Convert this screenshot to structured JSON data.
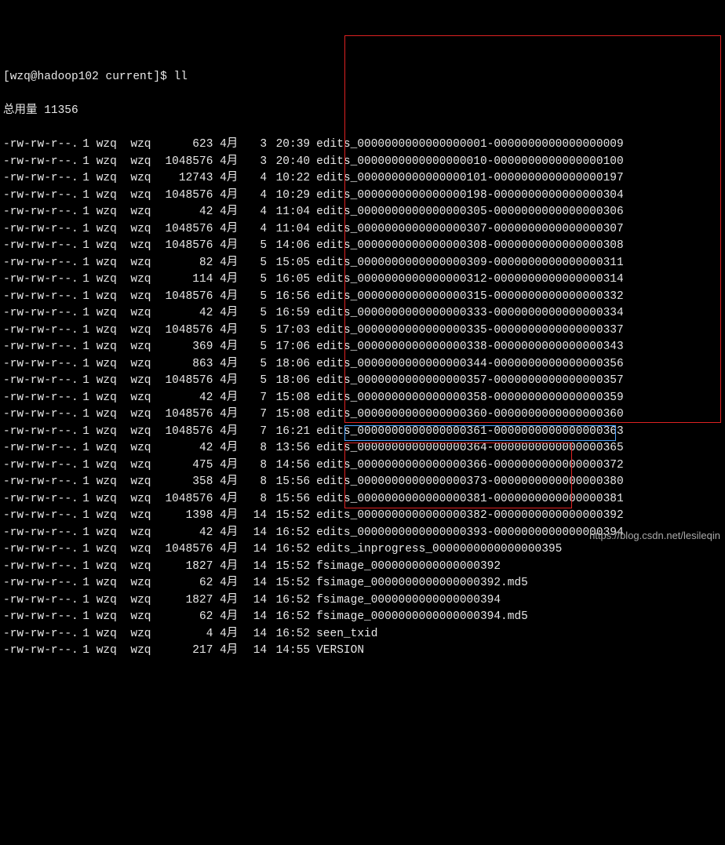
{
  "prompt": "[wzq@hadoop102 current]$ ll",
  "total_line": "总用量 11356",
  "watermark": "https://blog.csdn.net/lesileqin",
  "rows": [
    {
      "perm": "-rw-rw-r--.",
      "links": "1",
      "owner": "wzq",
      "group": "wzq",
      "size": "623",
      "month": "4月",
      "day": "3",
      "time": "20:39",
      "fname": "edits_0000000000000000001-0000000000000000009"
    },
    {
      "perm": "-rw-rw-r--.",
      "links": "1",
      "owner": "wzq",
      "group": "wzq",
      "size": "1048576",
      "month": "4月",
      "day": "3",
      "time": "20:40",
      "fname": "edits_0000000000000000010-0000000000000000100"
    },
    {
      "perm": "-rw-rw-r--.",
      "links": "1",
      "owner": "wzq",
      "group": "wzq",
      "size": "12743",
      "month": "4月",
      "day": "4",
      "time": "10:22",
      "fname": "edits_0000000000000000101-0000000000000000197"
    },
    {
      "perm": "-rw-rw-r--.",
      "links": "1",
      "owner": "wzq",
      "group": "wzq",
      "size": "1048576",
      "month": "4月",
      "day": "4",
      "time": "10:29",
      "fname": "edits_0000000000000000198-0000000000000000304"
    },
    {
      "perm": "-rw-rw-r--.",
      "links": "1",
      "owner": "wzq",
      "group": "wzq",
      "size": "42",
      "month": "4月",
      "day": "4",
      "time": "11:04",
      "fname": "edits_0000000000000000305-0000000000000000306"
    },
    {
      "perm": "-rw-rw-r--.",
      "links": "1",
      "owner": "wzq",
      "group": "wzq",
      "size": "1048576",
      "month": "4月",
      "day": "4",
      "time": "11:04",
      "fname": "edits_0000000000000000307-0000000000000000307"
    },
    {
      "perm": "-rw-rw-r--.",
      "links": "1",
      "owner": "wzq",
      "group": "wzq",
      "size": "1048576",
      "month": "4月",
      "day": "5",
      "time": "14:06",
      "fname": "edits_0000000000000000308-0000000000000000308"
    },
    {
      "perm": "-rw-rw-r--.",
      "links": "1",
      "owner": "wzq",
      "group": "wzq",
      "size": "82",
      "month": "4月",
      "day": "5",
      "time": "15:05",
      "fname": "edits_0000000000000000309-0000000000000000311"
    },
    {
      "perm": "-rw-rw-r--.",
      "links": "1",
      "owner": "wzq",
      "group": "wzq",
      "size": "114",
      "month": "4月",
      "day": "5",
      "time": "16:05",
      "fname": "edits_0000000000000000312-0000000000000000314"
    },
    {
      "perm": "-rw-rw-r--.",
      "links": "1",
      "owner": "wzq",
      "group": "wzq",
      "size": "1048576",
      "month": "4月",
      "day": "5",
      "time": "16:56",
      "fname": "edits_0000000000000000315-0000000000000000332"
    },
    {
      "perm": "-rw-rw-r--.",
      "links": "1",
      "owner": "wzq",
      "group": "wzq",
      "size": "42",
      "month": "4月",
      "day": "5",
      "time": "16:59",
      "fname": "edits_0000000000000000333-0000000000000000334"
    },
    {
      "perm": "-rw-rw-r--.",
      "links": "1",
      "owner": "wzq",
      "group": "wzq",
      "size": "1048576",
      "month": "4月",
      "day": "5",
      "time": "17:03",
      "fname": "edits_0000000000000000335-0000000000000000337"
    },
    {
      "perm": "-rw-rw-r--.",
      "links": "1",
      "owner": "wzq",
      "group": "wzq",
      "size": "369",
      "month": "4月",
      "day": "5",
      "time": "17:06",
      "fname": "edits_0000000000000000338-0000000000000000343"
    },
    {
      "perm": "-rw-rw-r--.",
      "links": "1",
      "owner": "wzq",
      "group": "wzq",
      "size": "863",
      "month": "4月",
      "day": "5",
      "time": "18:06",
      "fname": "edits_0000000000000000344-0000000000000000356"
    },
    {
      "perm": "-rw-rw-r--.",
      "links": "1",
      "owner": "wzq",
      "group": "wzq",
      "size": "1048576",
      "month": "4月",
      "day": "5",
      "time": "18:06",
      "fname": "edits_0000000000000000357-0000000000000000357"
    },
    {
      "perm": "-rw-rw-r--.",
      "links": "1",
      "owner": "wzq",
      "group": "wzq",
      "size": "42",
      "month": "4月",
      "day": "7",
      "time": "15:08",
      "fname": "edits_0000000000000000358-0000000000000000359"
    },
    {
      "perm": "-rw-rw-r--.",
      "links": "1",
      "owner": "wzq",
      "group": "wzq",
      "size": "1048576",
      "month": "4月",
      "day": "7",
      "time": "15:08",
      "fname": "edits_0000000000000000360-0000000000000000360"
    },
    {
      "perm": "-rw-rw-r--.",
      "links": "1",
      "owner": "wzq",
      "group": "wzq",
      "size": "1048576",
      "month": "4月",
      "day": "7",
      "time": "16:21",
      "fname": "edits_0000000000000000361-0000000000000000363"
    },
    {
      "perm": "-rw-rw-r--.",
      "links": "1",
      "owner": "wzq",
      "group": "wzq",
      "size": "42",
      "month": "4月",
      "day": "8",
      "time": "13:56",
      "fname": "edits_0000000000000000364-0000000000000000365"
    },
    {
      "perm": "-rw-rw-r--.",
      "links": "1",
      "owner": "wzq",
      "group": "wzq",
      "size": "475",
      "month": "4月",
      "day": "8",
      "time": "14:56",
      "fname": "edits_0000000000000000366-0000000000000000372"
    },
    {
      "perm": "-rw-rw-r--.",
      "links": "1",
      "owner": "wzq",
      "group": "wzq",
      "size": "358",
      "month": "4月",
      "day": "8",
      "time": "15:56",
      "fname": "edits_0000000000000000373-0000000000000000380"
    },
    {
      "perm": "-rw-rw-r--.",
      "links": "1",
      "owner": "wzq",
      "group": "wzq",
      "size": "1048576",
      "month": "4月",
      "day": "8",
      "time": "15:56",
      "fname": "edits_0000000000000000381-0000000000000000381"
    },
    {
      "perm": "-rw-rw-r--.",
      "links": "1",
      "owner": "wzq",
      "group": "wzq",
      "size": "1398",
      "month": "4月",
      "day": "14",
      "time": "15:52",
      "fname": "edits_0000000000000000382-0000000000000000392"
    },
    {
      "perm": "-rw-rw-r--.",
      "links": "1",
      "owner": "wzq",
      "group": "wzq",
      "size": "42",
      "month": "4月",
      "day": "14",
      "time": "16:52",
      "fname": "edits_0000000000000000393-0000000000000000394"
    },
    {
      "perm": "-rw-rw-r--.",
      "links": "1",
      "owner": "wzq",
      "group": "wzq",
      "size": "1048576",
      "month": "4月",
      "day": "14",
      "time": "16:52",
      "fname": "edits_inprogress_0000000000000000395"
    },
    {
      "perm": "-rw-rw-r--.",
      "links": "1",
      "owner": "wzq",
      "group": "wzq",
      "size": "1827",
      "month": "4月",
      "day": "14",
      "time": "15:52",
      "fname": "fsimage_0000000000000000392"
    },
    {
      "perm": "-rw-rw-r--.",
      "links": "1",
      "owner": "wzq",
      "group": "wzq",
      "size": "62",
      "month": "4月",
      "day": "14",
      "time": "15:52",
      "fname": "fsimage_0000000000000000392.md5"
    },
    {
      "perm": "-rw-rw-r--.",
      "links": "1",
      "owner": "wzq",
      "group": "wzq",
      "size": "1827",
      "month": "4月",
      "day": "14",
      "time": "16:52",
      "fname": "fsimage_0000000000000000394"
    },
    {
      "perm": "-rw-rw-r--.",
      "links": "1",
      "owner": "wzq",
      "group": "wzq",
      "size": "62",
      "month": "4月",
      "day": "14",
      "time": "16:52",
      "fname": "fsimage_0000000000000000394.md5"
    },
    {
      "perm": "-rw-rw-r--.",
      "links": "1",
      "owner": "wzq",
      "group": "wzq",
      "size": "4",
      "month": "4月",
      "day": "14",
      "time": "16:52",
      "fname": "seen_txid"
    },
    {
      "perm": "-rw-rw-r--.",
      "links": "1",
      "owner": "wzq",
      "group": "wzq",
      "size": "217",
      "month": "4月",
      "day": "14",
      "time": "14:55",
      "fname": "VERSION"
    }
  ]
}
